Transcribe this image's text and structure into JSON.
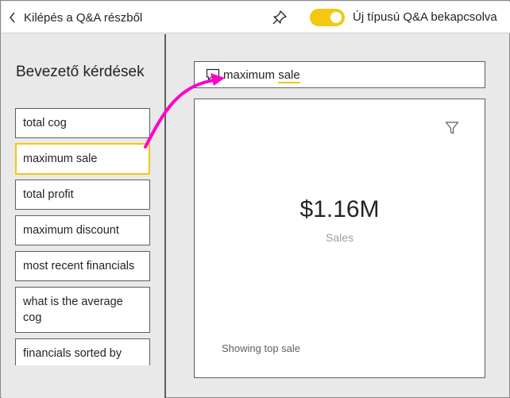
{
  "topbar": {
    "back_label": "Kilépés a Q&A részből",
    "toggle_label": "Új típusú Q&A bekapcsolva",
    "toggle_on": true
  },
  "left_panel": {
    "title": "Bevezető kérdések",
    "questions": [
      {
        "label": "total cog"
      },
      {
        "label": "maximum sale",
        "selected": true
      },
      {
        "label": "total profit"
      },
      {
        "label": "maximum discount"
      },
      {
        "label": "most recent financials"
      },
      {
        "label": "what is the average cog"
      },
      {
        "label": "financials sorted by"
      }
    ]
  },
  "qa": {
    "query_word1": "maximum",
    "query_word2": "sale"
  },
  "card": {
    "value": "$1.16M",
    "label": "Sales",
    "footer": "Showing top sale"
  },
  "icons": {
    "back": "chevron-left-icon",
    "pin": "pin-icon",
    "chat": "chat-icon",
    "filter": "filter-icon"
  },
  "colors": {
    "accent": "#f2c811",
    "annotation_arrow": "#ff00cc",
    "border": "#605e5c",
    "background": "#e9e9e9"
  }
}
